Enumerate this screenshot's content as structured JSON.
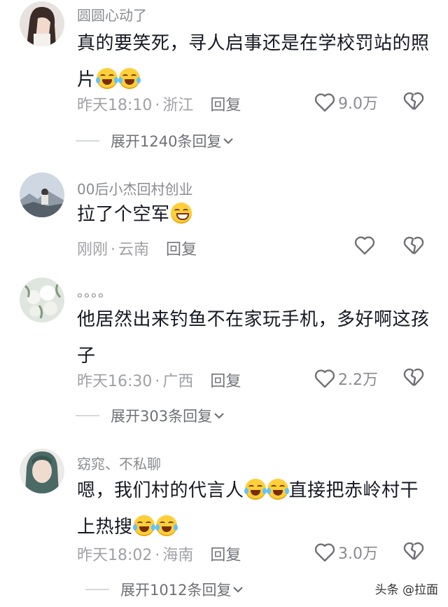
{
  "comments": [
    {
      "username": "圆圆心动了",
      "text": "真的要笑死，寻人启事还是在学校罚站的照片",
      "emoji_after": [
        "laugh-cry-emoji",
        "laugh-cry-emoji"
      ],
      "time": "昨天18:10",
      "location": "浙江",
      "reply_label": "回复",
      "likes": "9.0万",
      "expand_label": "展开1240条回复"
    },
    {
      "username": "00后小杰回村创业",
      "text": "拉了个空军",
      "emoji_after": [
        "grin-emoji"
      ],
      "time": "刚刚",
      "location": "云南",
      "reply_label": "回复",
      "likes": ""
    },
    {
      "username": "。。。。",
      "text": "他居然出来钓鱼不在家玩手机，多好啊这孩子",
      "time": "昨天16:30",
      "location": "广西",
      "reply_label": "回复",
      "likes": "2.2万",
      "expand_label": "展开303条回复"
    },
    {
      "username": "窈窕、不私聊",
      "text_part1": "嗯，我们村的代言人",
      "text_part2": "直接把赤岭村干上热搜",
      "time": "昨天18:02",
      "location": "海南",
      "reply_label": "回复",
      "likes": "3.0万",
      "expand_label": "展开1012条回复"
    }
  ],
  "watermark": "头条 @拉面",
  "separator": "·",
  "colors": {
    "text": "#161823",
    "meta": "#a0a1a7",
    "emoji": "#ffcf3a"
  }
}
